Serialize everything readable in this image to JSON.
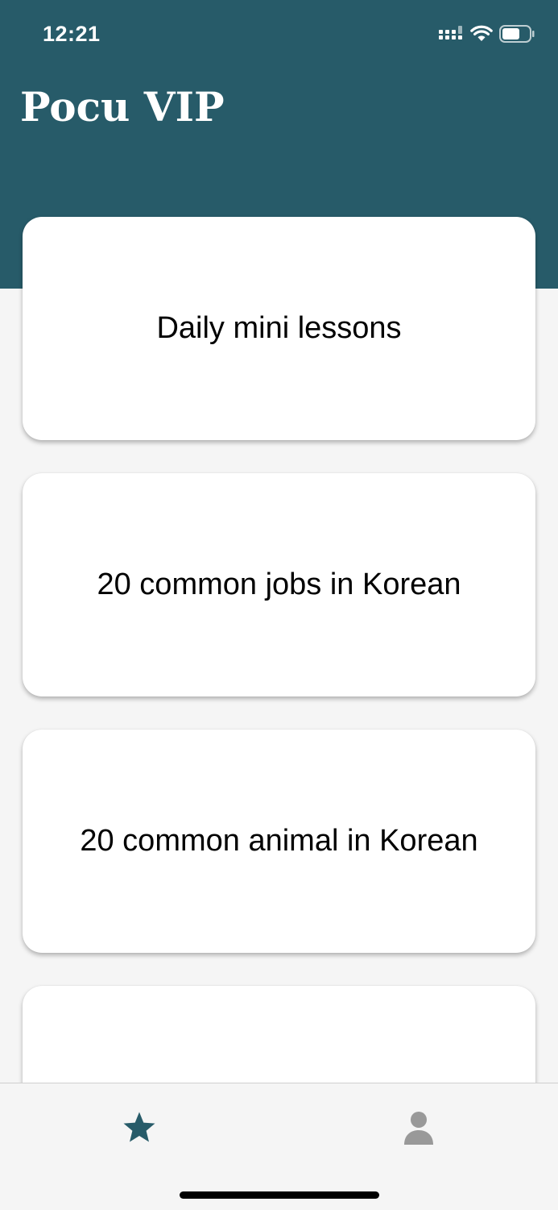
{
  "status_bar": {
    "time": "12:21"
  },
  "header": {
    "title": "Pocu VIP",
    "color": "#275b69"
  },
  "lessons": [
    {
      "label": "Daily mini lessons"
    },
    {
      "label": "20 common jobs in Korean"
    },
    {
      "label": "20 common animal in Korean"
    },
    {
      "label": ""
    }
  ],
  "tabs": [
    {
      "icon": "star-icon",
      "active": true,
      "color": "#275b69"
    },
    {
      "icon": "person-icon",
      "active": false,
      "color": "#999999"
    }
  ]
}
